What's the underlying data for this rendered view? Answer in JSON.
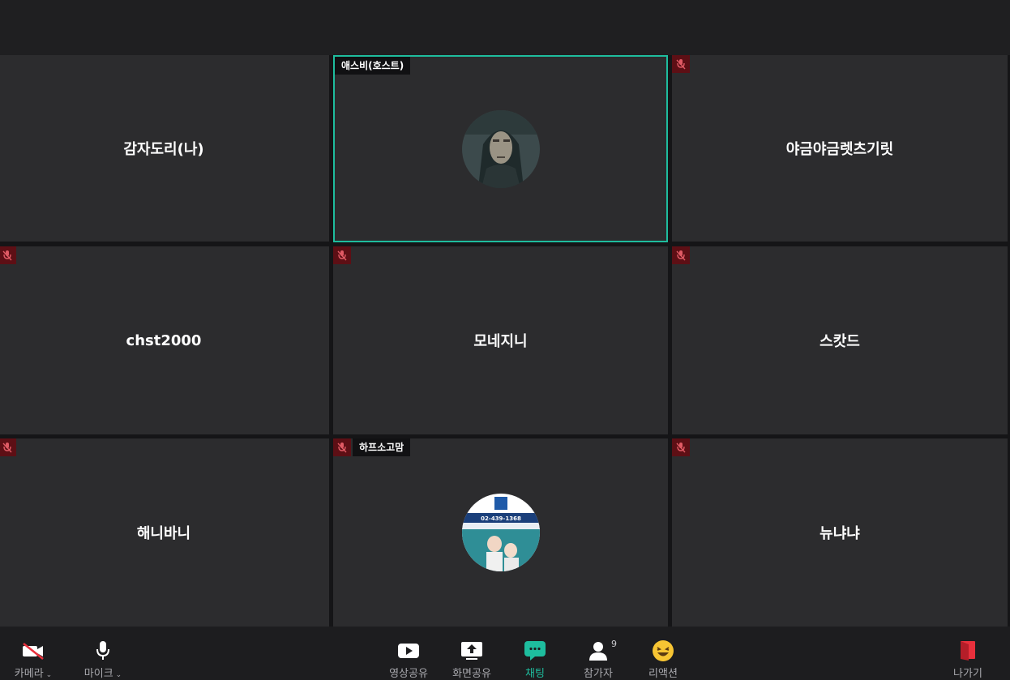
{
  "participants": [
    {
      "name": "감자도리(나)",
      "muted": false
    },
    {
      "name": "애스비(호스트)",
      "muted": false,
      "active": true,
      "avatar": "elderly-man-photo"
    },
    {
      "name": "야금야금렛츠기릿",
      "muted": true
    },
    {
      "name": "chst2000",
      "muted": true
    },
    {
      "name": "모네지니",
      "muted": true
    },
    {
      "name": "스캇드",
      "muted": true
    },
    {
      "name": "해니바니",
      "muted": true
    },
    {
      "name": "하프소고맘",
      "muted": true,
      "avatar": "tutoring-ad-photo"
    },
    {
      "name": "뉴냐냐",
      "muted": true
    }
  ],
  "avatar_ad": {
    "phone": "02-439-1368"
  },
  "toolbar": {
    "camera_label": "카메라",
    "mic_label": "마이크",
    "video_share_label": "영상공유",
    "screen_share_label": "화면공유",
    "chat_label": "채팅",
    "participants_label": "참가자",
    "participants_count": "9",
    "reaction_label": "리액션",
    "leave_label": "나가기"
  },
  "colors": {
    "accent": "#1ebd9e",
    "mute_bg": "#5d0f15",
    "leave": "#e8303c",
    "tile_bg": "#2c2c2e"
  }
}
